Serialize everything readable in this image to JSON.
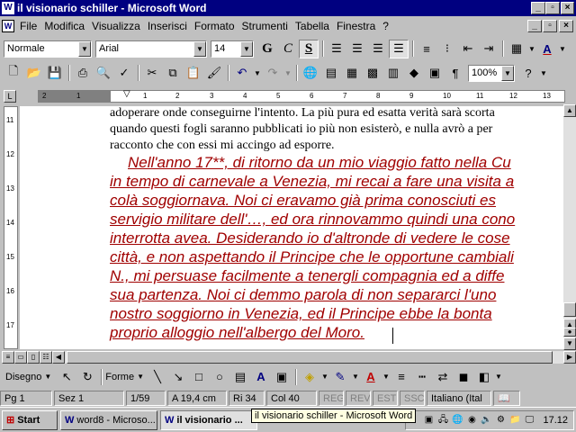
{
  "window": {
    "title": "il visionario schiller - Microsoft Word"
  },
  "menu": {
    "items": [
      "File",
      "Modifica",
      "Visualizza",
      "Inserisci",
      "Formato",
      "Strumenti",
      "Tabella",
      "Finestra",
      "?"
    ]
  },
  "format_toolbar": {
    "style": "Normale",
    "font": "Arial",
    "size": "14",
    "bold": "G",
    "italic": "C",
    "underline": "S",
    "font_color_letter": "A"
  },
  "standard_toolbar": {
    "zoom": "100%"
  },
  "ruler": {
    "marks": [
      "2",
      "1",
      "1",
      "2",
      "3",
      "4",
      "5",
      "6",
      "7",
      "8",
      "9",
      "10",
      "11",
      "12",
      "13"
    ],
    "vmarks": [
      "11",
      "12",
      "13",
      "14",
      "15",
      "16",
      "17"
    ]
  },
  "document": {
    "prior_lines": [
      "adoperare onde conseguirne l'intento. La più pura ed esatta verità sarà scorta",
      "quando questi fogli saranno pubblicati io più non esisterò, e nulla avrò a per",
      "racconto che con essi mi accingo ad esporre."
    ],
    "selected_lines": [
      "Nell'anno 17**, di ritorno da un mio viaggio fatto nella Cu",
      "in tempo di carnevale a Venezia, mi recai a fare una visita a",
      "colà soggiornava. Noi ci eravamo già prima conosciuti es",
      "servigio militare dell'…, ed ora rinnovammo quindi una cono",
      "interrotta avea. Desiderando io d'altronde di vedere le cose",
      "città, e non aspettando il Principe che le opportune cambiali",
      "N., mi persuase facilmente a tenergli compagnia ed a diffe",
      "sua partenza. Noi ci demmo parola di non separarci l'uno",
      "nostro soggiorno in Venezia, ed il Principe ebbe la bonta",
      "proprio alloggio nell'albergo del Moro."
    ]
  },
  "drawing_toolbar": {
    "draw": "Disegno",
    "autoshapes": "Forme"
  },
  "status": {
    "page": "Pg 1",
    "section": "Sez 1",
    "pages": "1/59",
    "position": "A  19,4 cm",
    "line": "Ri 34",
    "column": "Col 40",
    "rec": "REG",
    "rev": "REV",
    "ext": "EST",
    "ovr": "SSC",
    "language": "Italiano (Ital"
  },
  "taskbar": {
    "start": "Start",
    "tasks": [
      "word8 - Microso...",
      "il visionario ..."
    ],
    "tooltip": "il visionario schiller - Microsoft Word",
    "clock": "17.12"
  },
  "colors": {
    "title_bg": "#000080",
    "selection_text": "#a00000",
    "face": "#c0c0c0"
  }
}
